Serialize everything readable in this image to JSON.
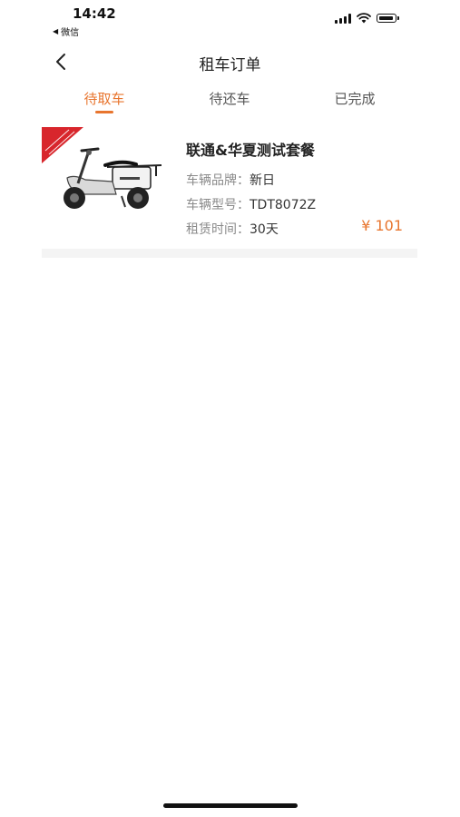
{
  "status_bar": {
    "time": "14:42",
    "back_app_label": "微信",
    "icons": [
      "signal-icon",
      "wifi-icon",
      "battery-icon"
    ]
  },
  "nav": {
    "title": "租车订单",
    "back_icon": "chevron-left-icon"
  },
  "tabs": [
    {
      "label": "待取车",
      "active": true
    },
    {
      "label": "待还车",
      "active": false
    },
    {
      "label": "已完成",
      "active": false
    }
  ],
  "orders": [
    {
      "name": "联通&华夏测试套餐",
      "brand_label": "车辆品牌：",
      "brand_value": "新日",
      "model_label": "车辆型号：",
      "model_value": "TDT8072Z",
      "duration_label": "租赁时间：",
      "duration_value": "30天",
      "price": "¥ 101",
      "image": "electric-scooter-image"
    }
  ],
  "colors": {
    "accent": "#e8752e",
    "label_gray": "#8a8a8a",
    "text_dark": "#222222",
    "divider": "#f4f4f4"
  }
}
